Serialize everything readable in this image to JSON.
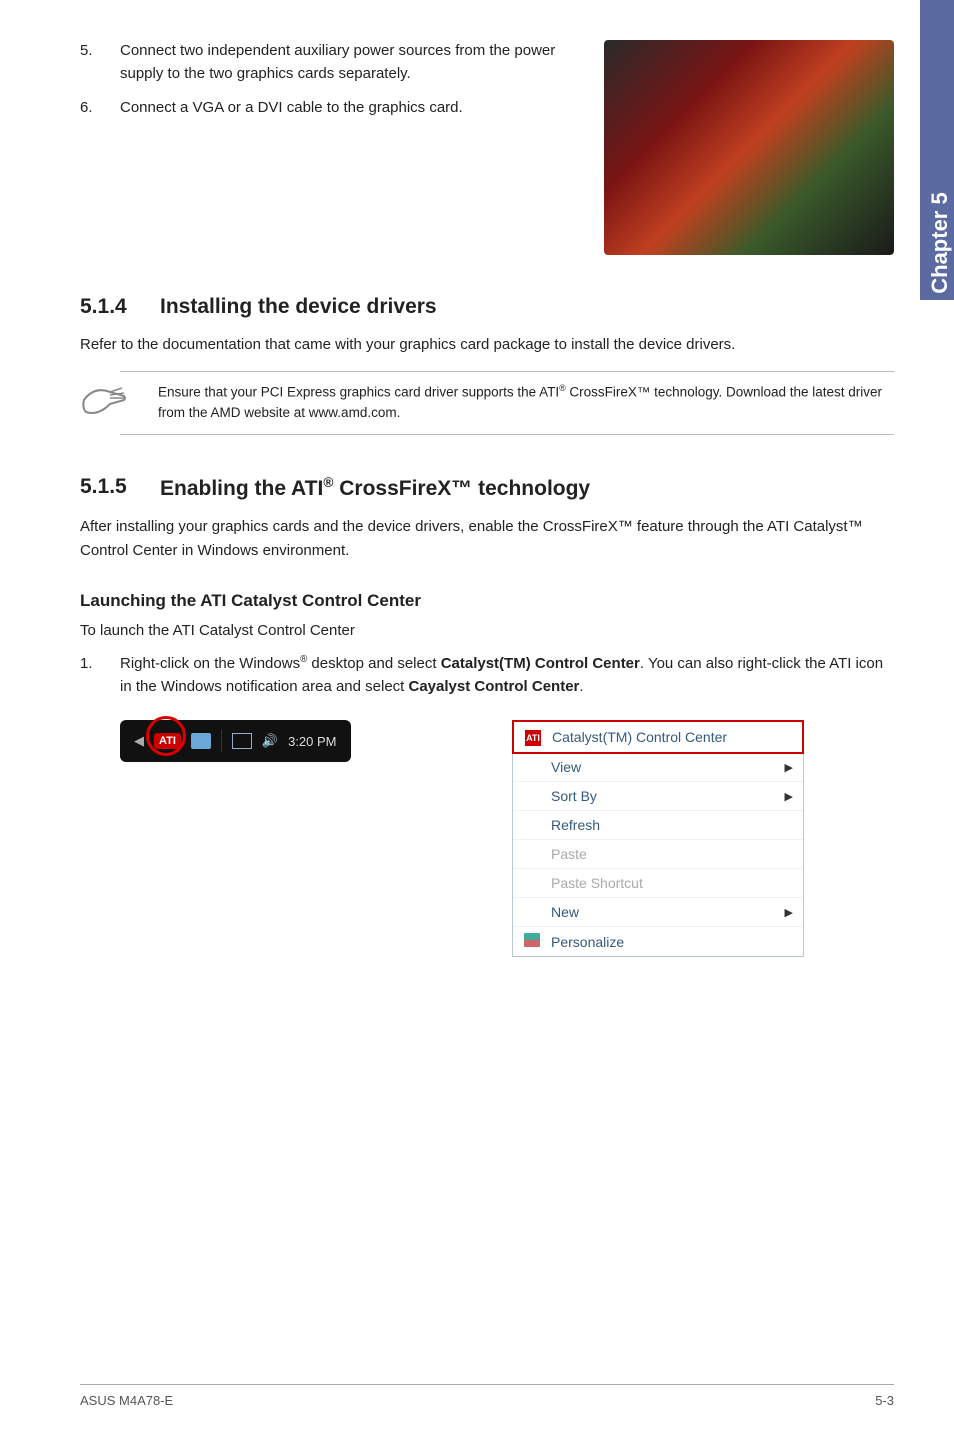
{
  "sideTab": "Chapter 5",
  "topSteps": [
    {
      "num": "5.",
      "text": "Connect two independent auxiliary power sources from the power supply to the two graphics cards separately."
    },
    {
      "num": "6.",
      "text": "Connect a VGA or a DVI cable to the graphics card."
    }
  ],
  "section514": {
    "num": "5.1.4",
    "title": "Installing the device drivers",
    "body": "Refer to the documentation that came with your graphics card package to install the device drivers.",
    "notePrefix": "Ensure that your PCI Express graphics card driver supports the ATI",
    "noteReg": "®",
    "noteSuffix": " CrossFireX™ technology. Download the latest driver from the AMD website at www.amd.com."
  },
  "section515": {
    "num": "5.1.5",
    "titlePrefix": "Enabling the ATI",
    "titleReg": "®",
    "titleSuffix": " CrossFireX™ technology",
    "body": "After installing your graphics cards and the device drivers, enable the CrossFireX™ feature through the ATI Catalyst™ Control Center in Windows environment.",
    "subHeader": "Launching the ATI Catalyst Control Center",
    "subBody": "To launch the ATI Catalyst Control Center",
    "step1": {
      "num": "1.",
      "pre": "Right-click on the Windows",
      "reg": "®",
      "mid": " desktop and select ",
      "bold1": "Catalyst(TM) Control Center",
      "post1": ". You can also right-click the ATI icon in the Windows notification area and select ",
      "bold2": "Cayalyst Control Center",
      "post2": "."
    }
  },
  "tray": {
    "atiLabel": "ATI",
    "time": "3:20 PM"
  },
  "contextMenu": {
    "items": [
      {
        "label": "Catalyst(TM) Control Center",
        "icon": "ati",
        "arrow": false,
        "disabled": false,
        "highlight": true
      },
      {
        "label": "View",
        "icon": "",
        "arrow": true,
        "disabled": false
      },
      {
        "label": "Sort By",
        "icon": "",
        "arrow": true,
        "disabled": false
      },
      {
        "label": "Refresh",
        "icon": "",
        "arrow": false,
        "disabled": false
      },
      {
        "label": "Paste",
        "icon": "",
        "arrow": false,
        "disabled": true
      },
      {
        "label": "Paste Shortcut",
        "icon": "",
        "arrow": false,
        "disabled": true
      },
      {
        "label": "New",
        "icon": "",
        "arrow": true,
        "disabled": false
      },
      {
        "label": "Personalize",
        "icon": "pers",
        "arrow": false,
        "disabled": false
      }
    ]
  },
  "footer": {
    "left": "ASUS M4A78-E",
    "right": "5-3"
  }
}
